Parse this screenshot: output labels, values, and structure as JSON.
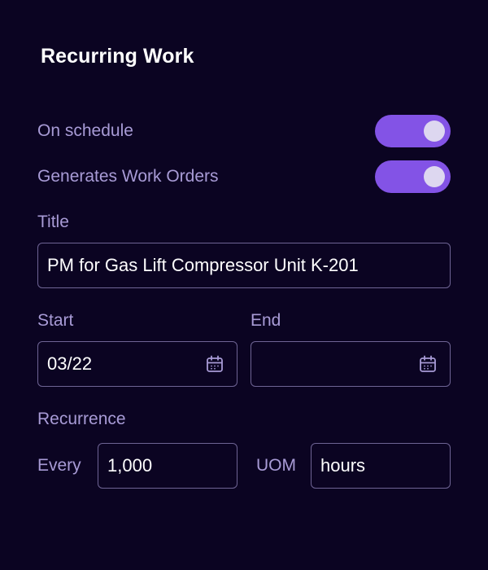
{
  "panel": {
    "title": "Recurring Work"
  },
  "toggles": {
    "on_schedule": {
      "label": "On schedule",
      "enabled": true
    },
    "generates_work_orders": {
      "label": "Generates Work Orders",
      "enabled": true
    }
  },
  "title_field": {
    "label": "Title",
    "value": "PM for Gas Lift Compressor Unit K-201"
  },
  "start_field": {
    "label": "Start",
    "value": "03/22",
    "icon": "calendar-icon"
  },
  "end_field": {
    "label": "End",
    "value": "",
    "icon": "calendar-icon"
  },
  "recurrence": {
    "label": "Recurrence",
    "every_label": "Every",
    "every_value": "1,000",
    "uom_label": "UOM",
    "uom_value": "hours"
  },
  "colors": {
    "background": "#0b0422",
    "accent": "#8353e6",
    "label_text": "#a89bd6",
    "field_border": "#6e6494"
  }
}
